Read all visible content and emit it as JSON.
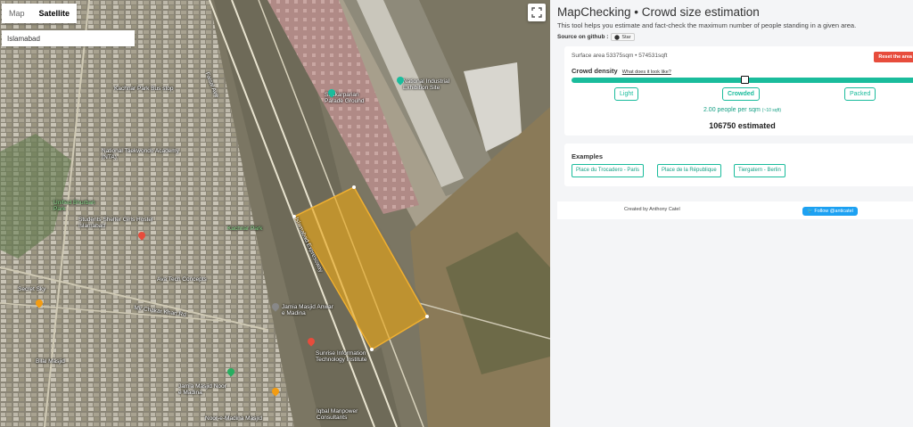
{
  "map": {
    "map_tab": "Map",
    "satellite_tab": "Satellite",
    "search_value": "Islamabad",
    "labels": [
      {
        "text": "Kachnar Park Bus stop"
      },
      {
        "text": "National Taekwondo Academy (NTA)"
      },
      {
        "text": "Unified Bhurban Park"
      },
      {
        "text": "Students Shelter Girls Hostel Islamabad"
      },
      {
        "text": "Kachnar Park"
      },
      {
        "text": "Jamia Masjid Anwar e Madina"
      },
      {
        "text": "Shakarparian Parade Ground"
      },
      {
        "text": "National Industrial Exhibition Site"
      },
      {
        "text": "Mir Chakar Khan Rd"
      },
      {
        "text": "Islamabad Expressway"
      },
      {
        "text": "Faisal Ave"
      },
      {
        "text": "Noor-e-Madina Masjid"
      },
      {
        "text": "Iqbal Manpower Consultants"
      },
      {
        "text": "Secret Sky"
      },
      {
        "text": "Ava Tech Concepts"
      },
      {
        "text": "Sunrise Information Technology Institute"
      },
      {
        "text": "Jamia Masjid Noor e Madina"
      },
      {
        "text": "Bilal Masjid"
      }
    ]
  },
  "panel": {
    "title": "MapChecking • Crowd size estimation",
    "subtitle": "This tool helps you estimate and fact-check the maximum number of people standing in a given area.",
    "source_label": "Source on github :",
    "star_label": "Star",
    "surface_area": "Surface area 53375sqm • 574531sqft",
    "reset_label": "Reset the area",
    "density_label": "Crowd density",
    "density_link": "What does it look like?",
    "density_value": 0.5,
    "buttons": {
      "light": "Light",
      "crowded": "Crowded",
      "packed": "Packed"
    },
    "per_sqm": "2.00 people per sqm",
    "per_sqft": "(~10 sqft)",
    "estimate": "106750 estimated",
    "examples_title": "Examples",
    "examples": [
      "Place du Trocadero - Paris",
      "Place de la République",
      "Tiergatern - Berlin"
    ],
    "created_by": "Created by Anthony Catel",
    "follow": "Follow @anticatel"
  },
  "colors": {
    "accent": "#1abc9c",
    "reset": "#e74c3c",
    "polygon": "#e0a020",
    "twitter": "#1da1f2"
  }
}
